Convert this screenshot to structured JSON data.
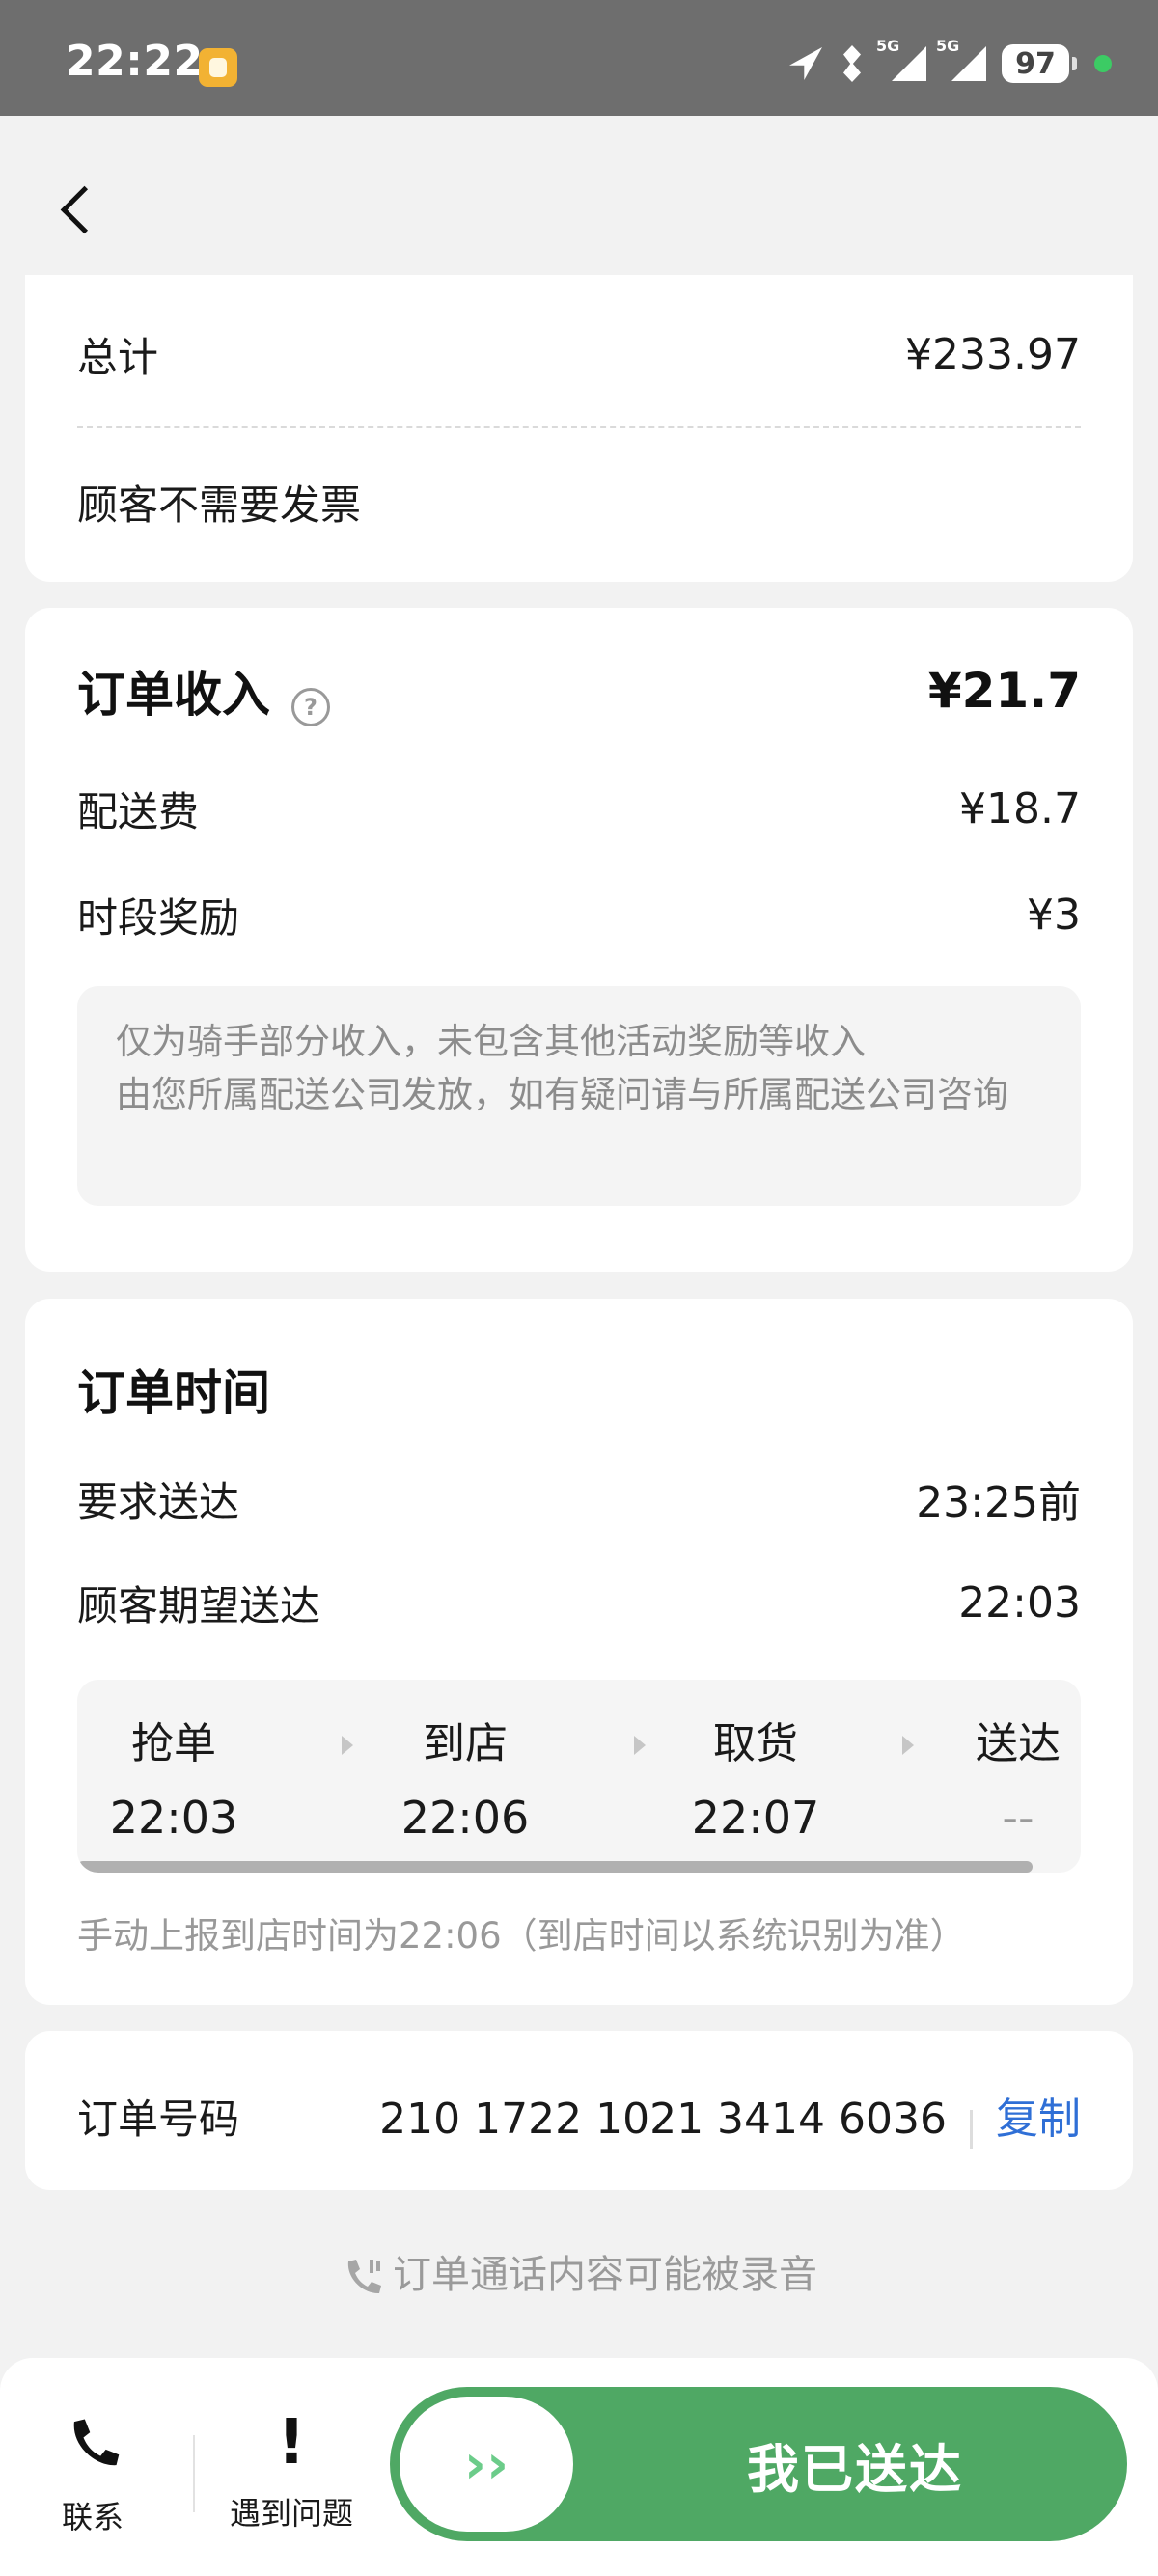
{
  "status_bar": {
    "time": "22:22",
    "battery": "97",
    "network_1": "5G",
    "network_2": "5G"
  },
  "summary": {
    "total_label": "总计",
    "total_value": "¥233.97",
    "invoice_note": "顾客不需要发票"
  },
  "income": {
    "title": "订单收入",
    "total": "¥21.7",
    "items": [
      {
        "label": "配送费",
        "value": "¥18.7"
      },
      {
        "label": "时段奖励",
        "value": "¥3"
      }
    ],
    "note_line1": "仅为骑手部分收入，未包含其他活动奖励等收入",
    "note_line2": "由您所属配送公司发放，如有疑问请与所属配送公司咨询"
  },
  "order_time": {
    "title": "订单时间",
    "required_label": "要求送达",
    "required_value": "23:25前",
    "expected_label": "顾客期望送达",
    "expected_value": "22:03",
    "steps": [
      {
        "label": "抢单",
        "time": "22:03"
      },
      {
        "label": "到店",
        "time": "22:06"
      },
      {
        "label": "取货",
        "time": "22:07"
      },
      {
        "label": "送达",
        "time": "--"
      }
    ],
    "manual_note": "手动上报到店时间为22:06（到店时间以系统识别为准）"
  },
  "order_number": {
    "label": "订单号码",
    "value": "210 1722 1021 3414 6036",
    "copy_label": "复制"
  },
  "call_note": "订单通话内容可能被录音",
  "bottom": {
    "contact_label": "联系",
    "problem_label": "遇到问题",
    "slide_label": "我已送达",
    "slide_arrows": "››"
  }
}
